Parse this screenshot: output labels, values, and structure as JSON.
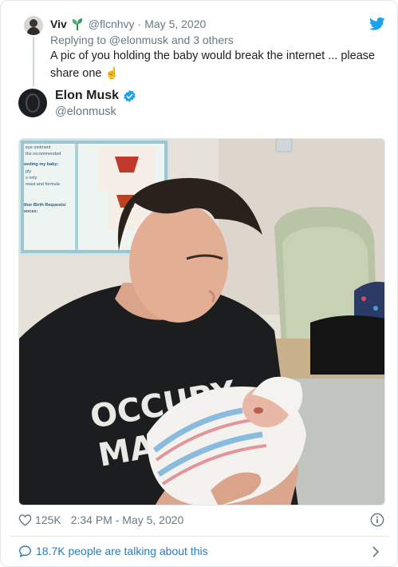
{
  "reply": {
    "name": "Viv",
    "handle": "@flcnhvy",
    "separator": "·",
    "date": "May 5, 2020",
    "replying_to": "Replying to @elonmusk and 3 others",
    "text": "A pic of you holding the baby would break the internet ... please share one",
    "emoji": "☝"
  },
  "author": {
    "name": "Elon Musk",
    "handle": "@elonmusk",
    "verified": true
  },
  "photo": {
    "shirt_line1": "OCCUPY",
    "shirt_line2": "MARS",
    "poster_lines": [
      "eye ointment",
      "the recommended",
      "eeding my baby:",
      "ply",
      "s only",
      "reast and formula",
      "ther Birth Requests/",
      "ences:"
    ]
  },
  "footer": {
    "likes": "125K",
    "timestamp": "2:34 PM - May 5, 2020",
    "talking": "18.7K people are talking about this"
  },
  "colors": {
    "link_blue": "#2b7bb9",
    "twitter_blue": "#1da1f2",
    "muted": "#697882",
    "text": "#1c2022"
  }
}
